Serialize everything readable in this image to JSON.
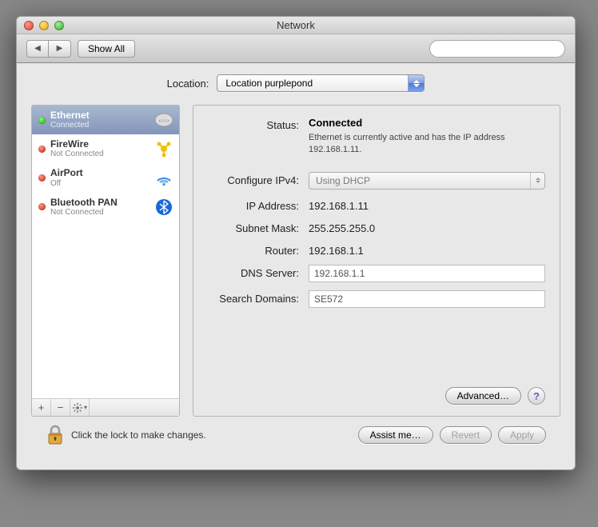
{
  "window": {
    "title": "Network"
  },
  "toolbar": {
    "show_all": "Show All",
    "search_placeholder": ""
  },
  "location": {
    "label": "Location:",
    "value": "Location purplepond"
  },
  "services": [
    {
      "name": "Ethernet",
      "status": "Connected",
      "dot": "g",
      "selected": true,
      "icon": "ethernet"
    },
    {
      "name": "FireWire",
      "status": "Not Connected",
      "dot": "r",
      "selected": false,
      "icon": "firewire"
    },
    {
      "name": "AirPort",
      "status": "Off",
      "dot": "r",
      "selected": false,
      "icon": "airport"
    },
    {
      "name": "Bluetooth PAN",
      "status": "Not Connected",
      "dot": "r",
      "selected": false,
      "icon": "bluetooth"
    }
  ],
  "detail": {
    "status_label": "Status:",
    "status_value": "Connected",
    "status_desc": "Ethernet is currently active and has the IP address 192.168.1.11.",
    "configure_label": "Configure IPv4:",
    "configure_value": "Using DHCP",
    "ip_label": "IP Address:",
    "ip_value": "192.168.1.11",
    "mask_label": "Subnet Mask:",
    "mask_value": "255.255.255.0",
    "router_label": "Router:",
    "router_value": "192.168.1.1",
    "dns_label": "DNS Server:",
    "dns_value": "192.168.1.1",
    "search_label": "Search Domains:",
    "search_value": "SE572",
    "advanced": "Advanced…"
  },
  "footer": {
    "lock_text": "Click the lock to make changes.",
    "assist": "Assist me…",
    "revert": "Revert",
    "apply": "Apply"
  }
}
